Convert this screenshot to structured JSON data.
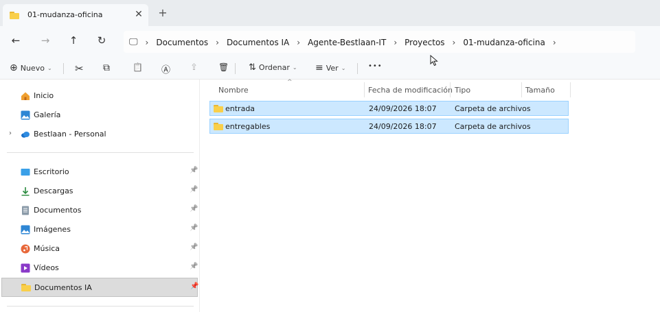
{
  "tab": {
    "title": "01-mudanza-oficina",
    "close_glyph": "✕",
    "new_tab_glyph": "+"
  },
  "nav": {
    "back_glyph": "←",
    "forward_glyph": "→",
    "up_glyph": "↑",
    "refresh_glyph": "↻",
    "computer_glyph": "🖵",
    "separator_glyph": "›",
    "breadcrumbs": [
      "Documentos",
      "Documentos IA",
      "Agente-Bestlaan-IT",
      "Proyectos",
      "01-mudanza-oficina"
    ]
  },
  "commands": {
    "new_label": "Nuevo",
    "new_glyph": "⊕",
    "cut_glyph": "✂",
    "copy_glyph": "⧉",
    "paste_glyph": "📋",
    "rename_glyph": "Ⓐ",
    "share_glyph": "⇪",
    "delete_glyph": "🗑",
    "sort_label": "Ordenar",
    "sort_glyph": "⇅",
    "view_label": "Ver",
    "view_glyph": "≡",
    "more_glyph": "•••",
    "chevron_glyph": "⌄"
  },
  "sidebar": {
    "top_items": [
      {
        "label": "Inicio",
        "icon": "home-icon"
      },
      {
        "label": "Galería",
        "icon": "gallery-icon"
      },
      {
        "label": "Bestlaan - Personal",
        "icon": "cloud-icon"
      }
    ],
    "expand_glyph": "›",
    "pin_glyph": "📌",
    "quick_access": [
      {
        "label": "Escritorio",
        "icon": "desktop-icon",
        "color": "#3aa0e8"
      },
      {
        "label": "Descargas",
        "icon": "download-icon",
        "color": "#2a8a3e"
      },
      {
        "label": "Documentos",
        "icon": "documents-icon",
        "color": "#8a9aa8"
      },
      {
        "label": "Imágenes",
        "icon": "pictures-icon",
        "color": "#2e86d4"
      },
      {
        "label": "Música",
        "icon": "music-icon",
        "color": "#e8683a"
      },
      {
        "label": "Vídeos",
        "icon": "videos-icon",
        "color": "#8a3ac8"
      },
      {
        "label": "Documentos IA",
        "icon": "folder-icon",
        "color": "#f9cf4a"
      }
    ]
  },
  "columns": {
    "name": "Nombre",
    "modified": "Fecha de modificación",
    "type": "Tipo",
    "size": "Tamaño",
    "sort_glyph": "^"
  },
  "files": [
    {
      "name": "entrada",
      "modified": "24/09/2026 18:07",
      "type": "Carpeta de archivos",
      "size": ""
    },
    {
      "name": "entregables",
      "modified": "24/09/2026 18:07",
      "type": "Carpeta de archivos",
      "size": ""
    }
  ],
  "colors": {
    "selection_fill": "#cce8ff",
    "selection_border": "#99d1ff",
    "folder_yellow": "#f9cf4a"
  }
}
